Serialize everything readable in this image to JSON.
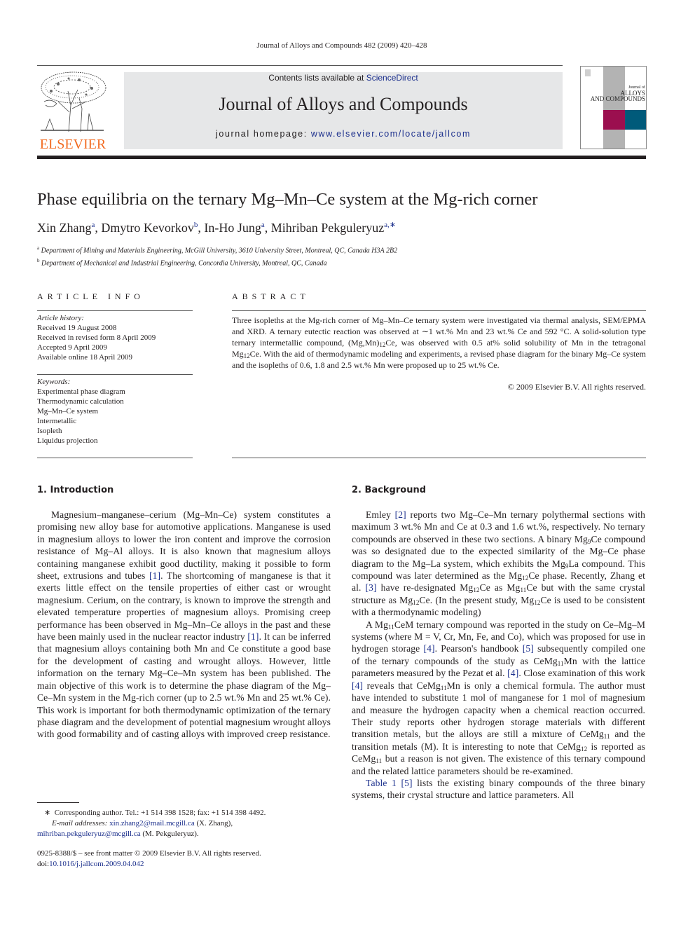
{
  "running_head": "Journal of Alloys and Compounds 482 (2009) 420–428",
  "masthead": {
    "publisher_logo": "ELSEVIER",
    "contents_prefix": "Contents lists available at ",
    "contents_link": "ScienceDirect",
    "journal_title": "Journal of Alloys and Compounds",
    "homepage_prefix": "journal homepage: ",
    "homepage_link": "www.elsevier.com/locate/jallcom",
    "cover_line1": "Journal of",
    "cover_line2": "ALLOYS",
    "cover_line3": "AND COMPOUNDS",
    "colors": {
      "logo_orange": "#f26b21",
      "link_blue": "#1b2f8c",
      "masthead_gray": "#e6e7e8",
      "cover_red": "#9b0f4f",
      "cover_blue": "#005a7a"
    }
  },
  "article": {
    "title": "Phase equilibria on the ternary Mg–Mn–Ce system at the Mg-rich corner",
    "authors": [
      {
        "name": "Xin Zhang",
        "sup": "a"
      },
      {
        "name": "Dmytro Kevorkov",
        "sup": "b"
      },
      {
        "name": "In-Ho Jung",
        "sup": "a"
      },
      {
        "name": "Mihriban Pekguleryuz",
        "sup": "a,∗"
      }
    ],
    "affiliations": [
      {
        "sup": "a",
        "text": "Department of Mining and Materials Engineering, McGill University, 3610 University Street, Montreal, QC, Canada H3A 2B2"
      },
      {
        "sup": "b",
        "text": "Department of Mechanical and Industrial Engineering, Concordia University, Montreal, QC, Canada"
      }
    ]
  },
  "article_info": {
    "label": "ARTICLE INFO",
    "history_label": "Article history:",
    "history": [
      "Received 19 August 2008",
      "Received in revised form 8 April 2009",
      "Accepted 9 April 2009",
      "Available online 18 April 2009"
    ],
    "keywords_label": "Keywords:",
    "keywords": [
      "Experimental phase diagram",
      "Thermodynamic calculation",
      "Mg–Mn–Ce system",
      "Intermetallic",
      "Isopleth",
      "Liquidus projection"
    ]
  },
  "abstract": {
    "label": "ABSTRACT",
    "p1": "Three isopleths at the Mg-rich corner of Mg–Mn–Ce ternary system were investigated via thermal analysis, SEM/EPMA and XRD. A ternary eutectic reaction was observed at ∼1 wt.% Mn and 23 wt.% Ce and 592 °C. A solid-solution type ternary intermetallic compound, (Mg,Mn)",
    "p1_sub": "12",
    "p2": "Ce, was observed with 0.5 at% solid solubility of Mn in the tetragonal Mg",
    "p2_sub": "12",
    "p3": "Ce. With the aid of thermodynamic modeling and experiments, a revised phase diagram for the binary Mg–Ce system and the isopleths of 0.6, 1.8 and 2.5 wt.% Mn were proposed up to 25 wt.% Ce.",
    "copyright": "© 2009 Elsevier B.V. All rights reserved."
  },
  "intro": {
    "heading": "1.  Introduction",
    "t1": "Magnesium–manganese–cerium (Mg–Mn–Ce) system constitutes a promising new alloy base for automotive applications. Manganese is used in magnesium alloys to lower the iron content and improve the corrosion resistance of Mg–Al alloys. It is also known that magnesium alloys containing manganese exhibit good ductility, making it possible to form sheet, extrusions and tubes ",
    "ref1": "[1]",
    "t2": ". The shortcoming of manganese is that it exerts little effect on the tensile properties of either cast or wrought magnesium. Cerium, on the contrary, is known to improve the strength and elevated temperature properties of magnesium alloys. Promising creep performance has been observed in Mg–Mn–Ce alloys in the past and these have been mainly used in the nuclear reactor industry ",
    "ref2": "[1]",
    "t3": ". It can be inferred that magnesium alloys containing both Mn and Ce constitute a good base for the development of casting and wrought alloys. However, little information on the ternary Mg–Ce–Mn system has been published. The main objective of this work is to determine the phase diagram of the Mg–Ce–Mn system in the Mg-rich corner (up to 2.5 wt.% Mn and 25 wt.% Ce). This work is important for both thermodynamic optimization of the ternary phase diagram and the development of potential magnesium wrought alloys with good formability and of casting alloys with improved creep resistance."
  },
  "background": {
    "heading": "2.  Background",
    "p1": {
      "a": "Emley ",
      "r2": "[2]",
      "b": " reports two Mg–Ce–Mn ternary polythermal sections with maximum 3 wt.% Mn and Ce at 0.3 and 1.6 wt.%, respectively. No ternary compounds are observed in these two sections. A binary Mg",
      "s1": "9",
      "c": "Ce compound was so designated due to the expected similarity of the Mg–Ce phase diagram to the Mg–La system, which exhibits the Mg",
      "s2": "9",
      "d": "La compound. This compound was later determined as the Mg",
      "s3": "12",
      "e": "Ce phase. Recently, Zhang et al. ",
      "r3": "[3]",
      "f": " have re-designated Mg",
      "s4": "12",
      "g": "Ce as Mg",
      "s5": "11",
      "h": "Ce but with the same crystal structure as Mg",
      "s6": "12",
      "i": "Ce. (In the present study, Mg",
      "s7": "12",
      "j": "Ce is used to be consistent with a thermodynamic modeling)"
    },
    "p2": {
      "a": "A Mg",
      "s1": "11",
      "b": "CeM ternary compound was reported in the study on Ce–Mg–M systems (where M = V, Cr, Mn, Fe, and Co), which was proposed for use in hydrogen storage ",
      "r4": "[4]",
      "c": ". Pearson's handbook ",
      "r5": "[5]",
      "d": " subsequently compiled one of the ternary compounds of the study as CeMg",
      "s2": "11",
      "e": "Mn with the lattice parameters measured by the Pezat et al. ",
      "r4b": "[4]",
      "f": ". Close examination of this work ",
      "r4c": "[4]",
      "g": " reveals that CeMg",
      "s3": "11",
      "h": "Mn is only a chemical formula. The author must have intended to substitute 1 mol of manganese for 1 mol of magnesium and measure the hydrogen capacity when a chemical reaction occurred. Their study reports other hydrogen storage materials with different transition metals, but the alloys are still a mixture of CeMg",
      "s4": "11",
      "i": " and the transition metals (M). It is interesting to note that CeMg",
      "s5": "12",
      "j": " is reported as CeMg",
      "s6": "11",
      "k": " but a reason is not given. The existence of this ternary compound and the related lattice parameters should be re-examined."
    },
    "p3": {
      "table_link": "Table 1",
      "r5": "[5]",
      "a": " lists the existing binary compounds of the three binary systems, their crystal structure and lattice parameters. All"
    }
  },
  "footnotes": {
    "star": "∗",
    "corresponding": "Corresponding author. Tel.: +1 514 398 1528; fax: +1 514 398 4492.",
    "email_label": "E-mail addresses:",
    "email1": "xin.zhang2@mail.mcgill.ca",
    "email1_who": " (X. Zhang),",
    "email2": "mihriban.pekguleryuz@mcgill.ca",
    "email2_who": " (M. Pekguleryuz).",
    "issn": "0925-8388/$ – see front matter © 2009 Elsevier B.V. All rights reserved.",
    "doi_label": "doi:",
    "doi": "10.1016/j.jallcom.2009.04.042"
  }
}
